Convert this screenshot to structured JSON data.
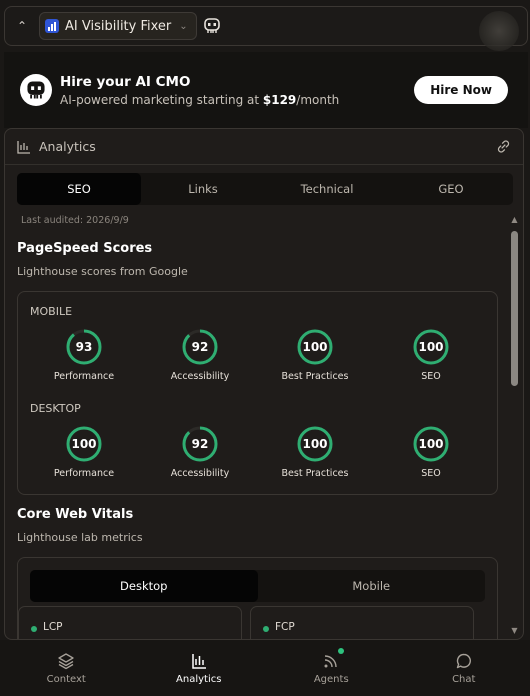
{
  "topbar": {
    "app_name": "AI Visibility Fixer"
  },
  "promo": {
    "title": "Hire your AI CMO",
    "sub_prefix": "AI-powered marketing starting at ",
    "price": "$129",
    "sub_suffix": "/month",
    "button": "Hire Now"
  },
  "analytics": {
    "title": "Analytics",
    "tabs": [
      "SEO",
      "Links",
      "Technical",
      "GEO"
    ],
    "active_tab": "SEO",
    "last_audited": "Last audited: 2026/9/9",
    "pagespeed": {
      "title": "PageSpeed Scores",
      "subtitle": "Lighthouse scores from Google",
      "mobile_label": "MOBILE",
      "desktop_label": "DESKTOP",
      "mobile": [
        {
          "label": "Performance",
          "value": 93
        },
        {
          "label": "Accessibility",
          "value": 92
        },
        {
          "label": "Best Practices",
          "value": 100
        },
        {
          "label": "SEO",
          "value": 100
        }
      ],
      "desktop": [
        {
          "label": "Performance",
          "value": 100
        },
        {
          "label": "Accessibility",
          "value": 92
        },
        {
          "label": "Best Practices",
          "value": 100
        },
        {
          "label": "SEO",
          "value": 100
        }
      ]
    },
    "cwv": {
      "title": "Core Web Vitals",
      "subtitle": "Lighthouse lab metrics",
      "tabs": [
        "Desktop",
        "Mobile"
      ],
      "active_tab": "Desktop",
      "metrics": [
        "LCP",
        "FCP"
      ]
    }
  },
  "nav": [
    {
      "label": "Context",
      "icon": "layers-icon"
    },
    {
      "label": "Analytics",
      "icon": "bar-chart-icon"
    },
    {
      "label": "Agents",
      "icon": "rss-icon"
    },
    {
      "label": "Chat",
      "icon": "chat-bubble-icon"
    }
  ],
  "colors": {
    "accent_green": "#2fae72",
    "background": "#1a1816"
  }
}
